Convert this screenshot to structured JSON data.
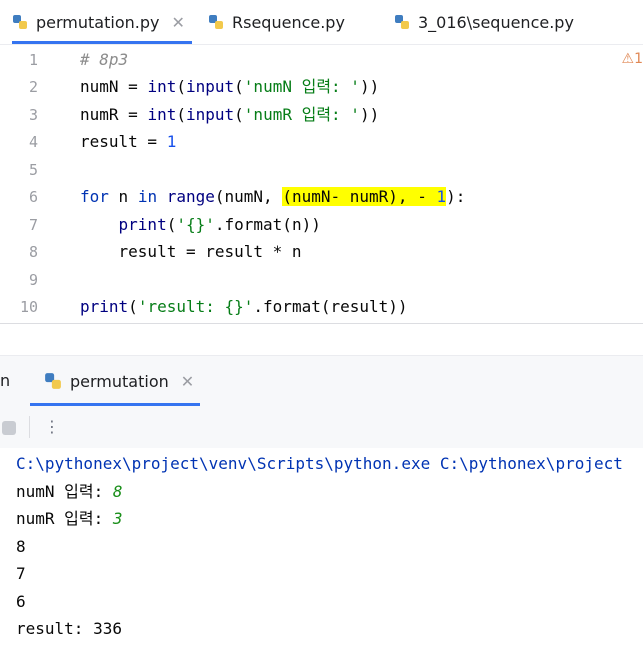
{
  "tabs": [
    {
      "label": "permutation.py",
      "active": true,
      "closable": true
    },
    {
      "label": "Rsequence.py",
      "active": false,
      "closable": false
    },
    {
      "label": "3_016\\sequence.py",
      "active": false,
      "closable": false
    }
  ],
  "warning_count": "1",
  "code_lines": [
    {
      "n": "1",
      "text": "# 8p3"
    },
    {
      "n": "2",
      "text": "numN = int(input('numN 입력: '))"
    },
    {
      "n": "3",
      "text": "numR = int(input('numR 입력: '))"
    },
    {
      "n": "4",
      "text": "result = 1"
    },
    {
      "n": "5",
      "text": ""
    },
    {
      "n": "6",
      "text": "for n in range(numN, (numN- numR), - 1):"
    },
    {
      "n": "7",
      "text": "    print('{}'.format(n))"
    },
    {
      "n": "8",
      "text": "    result = result * n"
    },
    {
      "n": "9",
      "text": ""
    },
    {
      "n": "10",
      "text": "print('result: {}'.format(result))"
    }
  ],
  "run_panel": {
    "cut_label": "n",
    "tab_label": "permutation"
  },
  "console": {
    "command": "C:\\pythonex\\project\\venv\\Scripts\\python.exe C:\\pythonex\\project",
    "prompt1": "numN 입력: ",
    "input1": "8",
    "prompt2": "numR 입력: ",
    "input2": "3",
    "out1": "8",
    "out2": "7",
    "out3": "6",
    "result": "result: 336"
  },
  "icons": [
    "python-file-icon",
    "close-icon",
    "warning-icon",
    "stop-icon",
    "more-options-icon"
  ],
  "colors": {
    "accent": "#3574f0",
    "highlight": "#ffff00",
    "keyword": "#0033b3",
    "string": "#067d17",
    "number": "#1750eb"
  }
}
